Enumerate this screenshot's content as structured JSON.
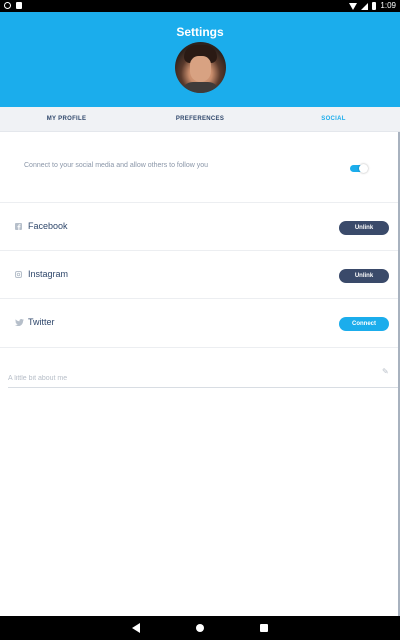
{
  "status_bar": {
    "time": "1:09",
    "icons": [
      "notification-circle-icon",
      "sd-card-icon",
      "wifi-icon",
      "cell-signal-icon",
      "battery-icon"
    ]
  },
  "header": {
    "title": "Settings",
    "background": "#1badec"
  },
  "tabs": [
    {
      "label": "MY PROFILE",
      "active": false
    },
    {
      "label": "PREFERENCES",
      "active": false
    },
    {
      "label": "SOCIAL",
      "active": true
    }
  ],
  "social": {
    "connect_text": "Connect to your social media and allow others to follow you",
    "connect_toggle_on": true,
    "accounts": [
      {
        "name": "Facebook",
        "icon": "facebook-icon",
        "action": "Unlink"
      },
      {
        "name": "Instagram",
        "icon": "instagram-icon",
        "action": "Unlink"
      },
      {
        "name": "Twitter",
        "icon": "twitter-icon",
        "action": "Connect"
      }
    ],
    "about_placeholder": "A little bit about me",
    "about_value": ""
  },
  "colors": {
    "accent": "#1badec",
    "unlink_button": "#3a4a6a",
    "text_dark": "#2f476b"
  }
}
